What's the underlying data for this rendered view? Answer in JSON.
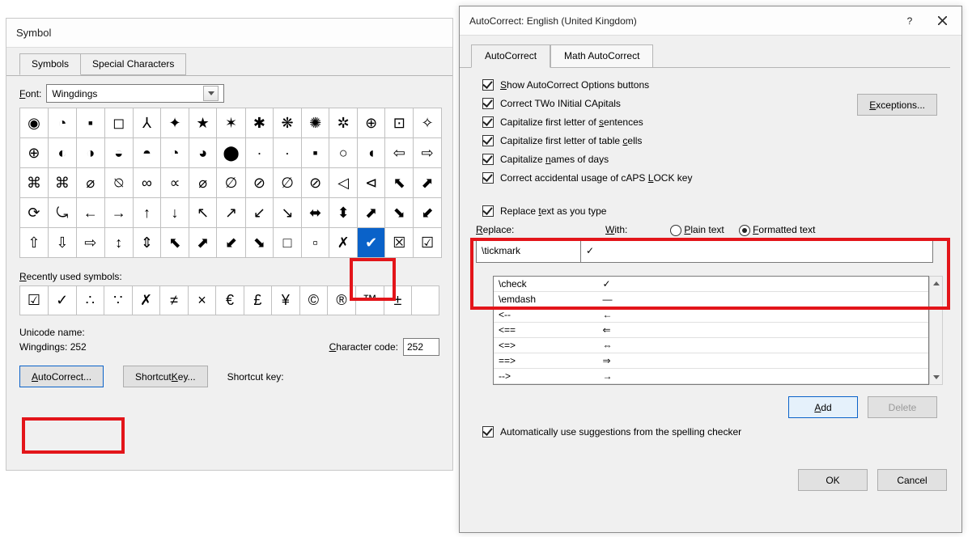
{
  "symbolDlg": {
    "title": "Symbol",
    "tabs": [
      "Symbols",
      "Special Characters"
    ],
    "fontLabel": "Font:",
    "fontValue": "Wingdings",
    "grid": [
      [
        "◉",
        "◔",
        "▪",
        "◻",
        "⅄",
        "✦",
        "★",
        "✶",
        "✱",
        "❋",
        "✺",
        "✲",
        "⊕",
        "⊡",
        "✧"
      ],
      [
        "⊕",
        "◐",
        "◑",
        "◒",
        "◓",
        "◔",
        "◕",
        "⬤",
        "·",
        "∙",
        "▪",
        "○",
        "◖",
        "⇦",
        "⇨"
      ],
      [
        "⌘",
        "⌘",
        "⌀",
        "⍉",
        "∞",
        "∝",
        "⌀",
        "∅",
        "⊘",
        "∅",
        "⊘",
        "◁",
        "⊲",
        "⬉",
        "⬈"
      ],
      [
        "⟳",
        "⤿",
        "←",
        "→",
        "↑",
        "↓",
        "↖",
        "↗",
        "↙",
        "↘",
        "⬌",
        "⬍",
        "⬈",
        "⬊",
        "⬋"
      ],
      [
        "⇧",
        "⇩",
        "⇨",
        "↕",
        "⇕",
        "⬉",
        "⬈",
        "⬋",
        "⬊",
        "□",
        "▫",
        "✗",
        "✔",
        "☒",
        "☑"
      ]
    ],
    "selected": {
      "row": 4,
      "col": 12
    },
    "recentLabel": "Recently used symbols:",
    "recent": [
      "☑",
      "✓",
      "∴",
      "∵",
      "✗",
      "≠",
      "×",
      "€",
      "£",
      "¥",
      "©",
      "®",
      "™",
      "±",
      ""
    ],
    "unicodeNameLabel": "Unicode name:",
    "unicodeName": "Wingdings: 252",
    "charCodeLabel": "Character code:",
    "charCode": "252",
    "autoCorrectBtn": "AutoCorrect...",
    "shortcutKeyBtn": "Shortcut Key...",
    "shortcutKeyLabel": "Shortcut key:"
  },
  "acDlg": {
    "title": "AutoCorrect: English (United Kingdom)",
    "help": "?",
    "tabs": [
      "AutoCorrect",
      "Math AutoCorrect"
    ],
    "checks": {
      "showOptions": "Show AutoCorrect Options buttons",
      "twoInitial": "Correct TWo INitial CApitals",
      "firstSentence": "Capitalize first letter of sentences",
      "firstTable": "Capitalize first letter of table cells",
      "daysNames": "Capitalize names of days",
      "capsLock": "Correct accidental usage of cAPS LOCK key",
      "replaceTyping": "Replace text as you type",
      "spellingSuggest": "Automatically use suggestions from the spelling checker"
    },
    "exceptionsBtn": "Exceptions...",
    "replaceLabel": "Replace:",
    "withLabel": "With:",
    "plainText": "Plain text",
    "formattedText": "Formatted text",
    "replaceValue": "\\tickmark",
    "withValue": "✓",
    "list": [
      {
        "r": "\\check",
        "w": "✓"
      },
      {
        "r": "\\emdash",
        "w": "—"
      },
      {
        "r": "<--",
        "w": "←"
      },
      {
        "r": "<==",
        "w": "⇐"
      },
      {
        "r": "<=>",
        "w": "⇔"
      },
      {
        "r": "==>",
        "w": "⇒"
      },
      {
        "r": "-->",
        "w": "→"
      }
    ],
    "addBtn": "Add",
    "deleteBtn": "Delete",
    "okBtn": "OK",
    "cancelBtn": "Cancel"
  }
}
